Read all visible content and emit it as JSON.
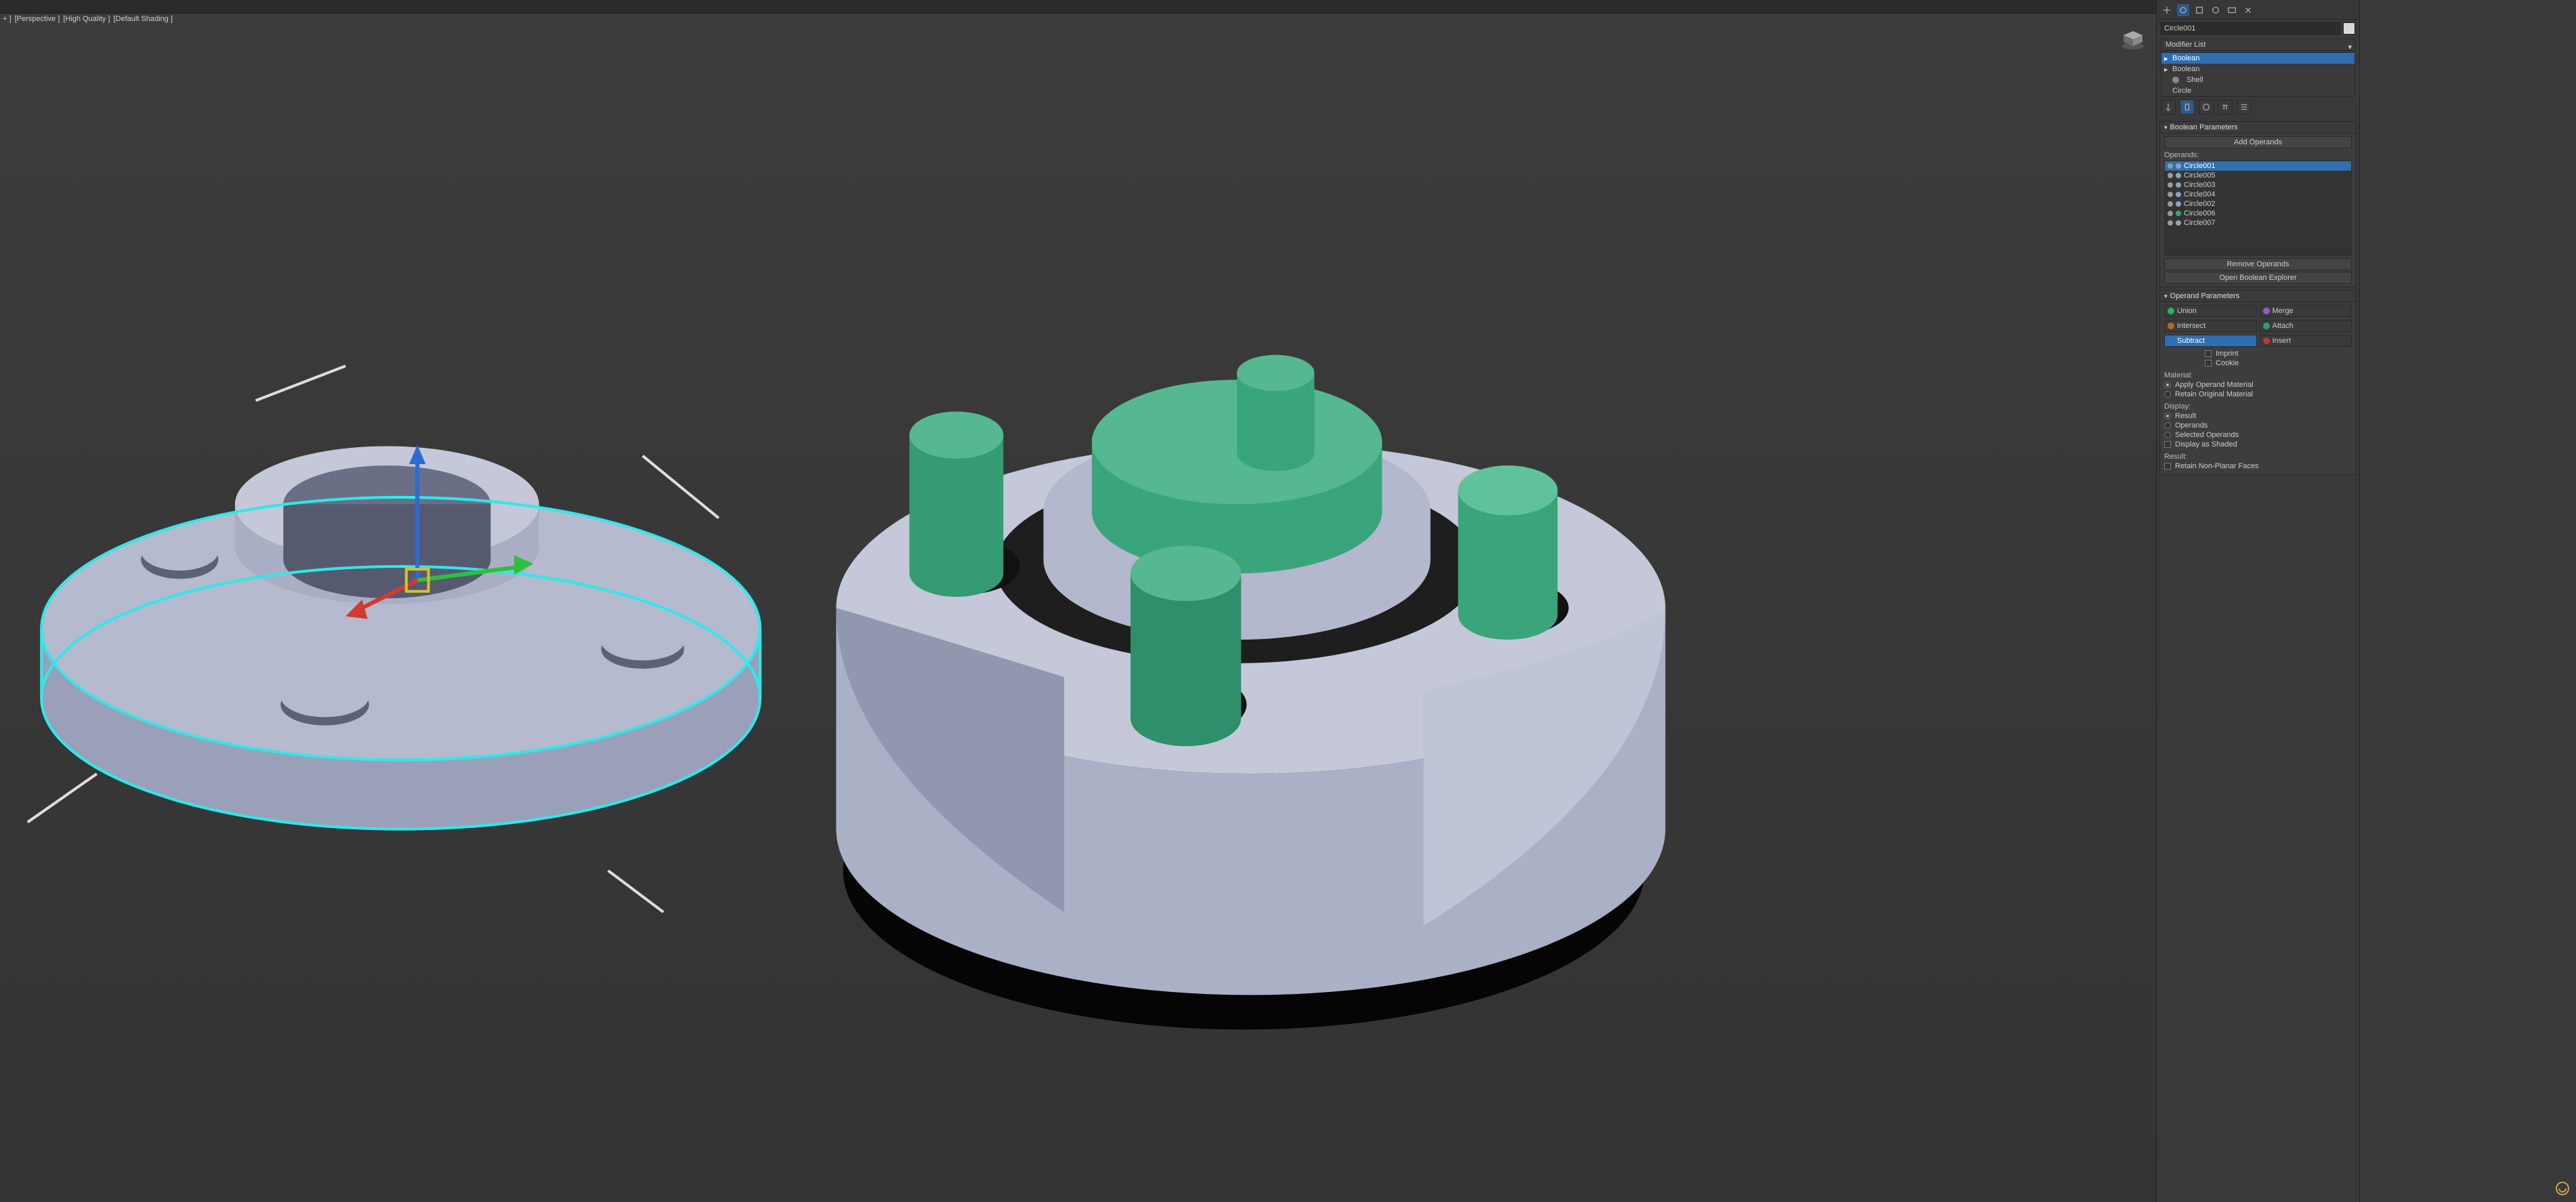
{
  "viewport": {
    "label1": "+ ]",
    "label2": "[Perspective ]",
    "label3": "[High Quality ]",
    "label4": "[Default Shading ]"
  },
  "cmd": {
    "obj_name": "Circle001",
    "mod_list_label": "Modifier List",
    "stack": [
      {
        "label": "Boolean",
        "sel": true,
        "caret": true
      },
      {
        "label": "Boolean",
        "sel": false,
        "caret": true
      },
      {
        "label": "Shell",
        "sel": false,
        "eye": true
      },
      {
        "label": "Circle",
        "sel": false,
        "caret": false
      }
    ],
    "boolean_params": {
      "title": "Boolean Parameters",
      "add": "Add Operands",
      "ops_label": "Operands:",
      "ops": [
        {
          "name": "Circle001",
          "sel": true,
          "col": "blue"
        },
        {
          "name": "Circle005",
          "col": "blue"
        },
        {
          "name": "Circle003",
          "col": "blue"
        },
        {
          "name": "Circle004",
          "col": "blue"
        },
        {
          "name": "Circle002",
          "col": "blue"
        },
        {
          "name": "Circle006",
          "col": "green"
        },
        {
          "name": "Circle007",
          "col": "blue"
        }
      ],
      "remove": "Remove Operands",
      "open": "Open Boolean Explorer"
    },
    "operand_params": {
      "title": "Operand Parameters",
      "buttons": {
        "union": "Union",
        "merge": "Merge",
        "intersect": "Intersect",
        "attach": "Attach",
        "subtract": "Subtract",
        "insert": "Insert"
      },
      "imprint": "Imprint",
      "cookie": "Cookie",
      "material_label": "Material:",
      "mat_apply": "Apply Operand Material",
      "mat_retain": "Retain Original Material",
      "display_label": "Display:",
      "disp_result": "Result",
      "disp_operands": "Operands",
      "disp_sel": "Selected Operands",
      "disp_shaded": "Display as Shaded",
      "result_label": "Result:",
      "retain_np": "Retain Non-Planar Faces"
    }
  }
}
